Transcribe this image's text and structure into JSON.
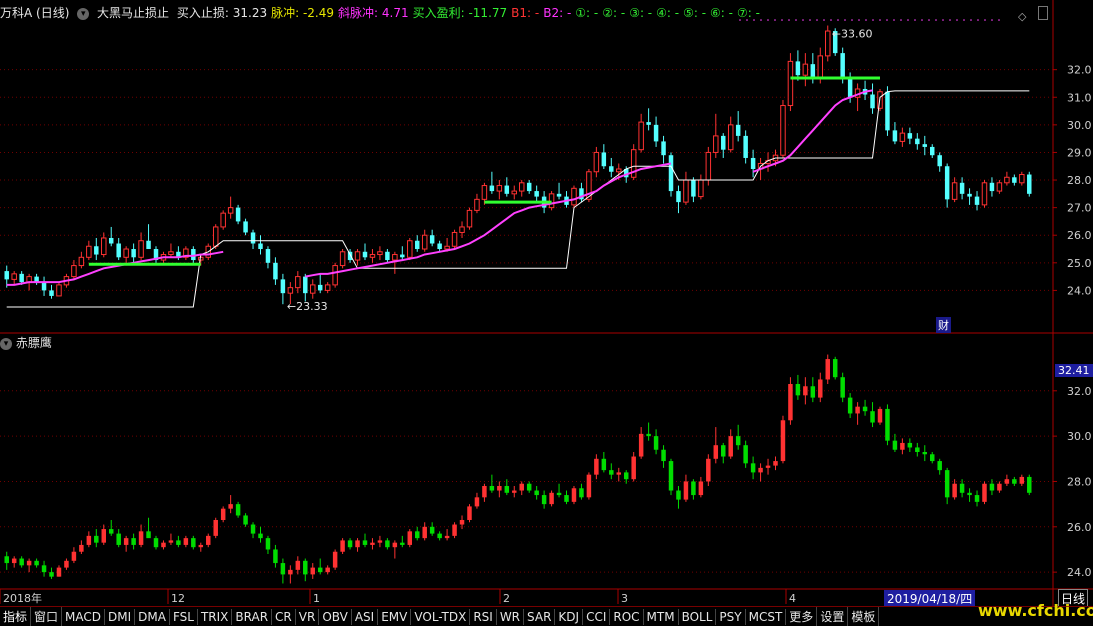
{
  "header": {
    "stock_name": "万科A (日线)",
    "indicator_name": "大黑马止损止",
    "items": [
      {
        "label": "买入止损: 31.23",
        "color": "#e6e6e6"
      },
      {
        "label": "脉冲: -2.49",
        "color": "#e6e600"
      },
      {
        "label": "斜脉冲: 4.71",
        "color": "#ff33ff"
      },
      {
        "label": "买入盈利: -11.77",
        "color": "#33ee33"
      },
      {
        "label": "B1: -",
        "color": "#ff3333"
      },
      {
        "label": "B2: -",
        "color": "#ff33ff"
      },
      {
        "label": "①: -",
        "color": "#33ee33"
      },
      {
        "label": "②: -",
        "color": "#33ee33"
      },
      {
        "label": "③: -",
        "color": "#33ee33"
      },
      {
        "label": "④: -",
        "color": "#33ee33"
      },
      {
        "label": "⑤: -",
        "color": "#33ee33"
      },
      {
        "label": "⑥: -",
        "color": "#33ee33"
      },
      {
        "label": "⑦: -",
        "color": "#33ee33"
      }
    ]
  },
  "sub_panel": {
    "title": "赤膘鹰"
  },
  "annotations": {
    "high": "33.60",
    "low": "23.33",
    "finance_badge": "财"
  },
  "crosshair": {
    "date": "2019/04/18/四",
    "price": "32.41"
  },
  "period": "日线",
  "toolbar": {
    "tabs": [
      "指标",
      "窗口",
      "MACD",
      "DMI",
      "DMA",
      "FSL",
      "TRIX",
      "BRAR",
      "CR",
      "VR",
      "OBV",
      "ASI",
      "EMV",
      "VOL-TDX",
      "RSI",
      "WR",
      "SAR",
      "KDJ",
      "CCI",
      "ROC",
      "MTM",
      "BOLL",
      "PSY",
      "MCST",
      "更多",
      "设置",
      "模板"
    ]
  },
  "watermark": "www.cfchi.com",
  "colors": {
    "up": "#ff3232",
    "down": "#54ffff",
    "down_sub": "#00dd00",
    "ma": "#ff40ff",
    "stop": "#ffffff",
    "bar_green": "#30ff30",
    "grid": "#700000"
  },
  "chart_data": [
    {
      "type": "candlestick",
      "title": "万科A (日线)",
      "x_labels": [
        "2018年",
        "12",
        "1",
        "2",
        "3",
        "4"
      ],
      "ylim": [
        23.0,
        33.8
      ],
      "y_ticks": [
        24.0,
        25.0,
        26.0,
        27.0,
        28.0,
        29.0,
        30.0,
        31.0,
        32.0
      ],
      "candles": [
        [
          24.7,
          24.9,
          24.1,
          24.4
        ],
        [
          24.4,
          24.7,
          24.2,
          24.6
        ],
        [
          24.6,
          24.7,
          24.2,
          24.3
        ],
        [
          24.3,
          24.6,
          24.0,
          24.5
        ],
        [
          24.5,
          24.6,
          24.2,
          24.3
        ],
        [
          24.3,
          24.5,
          23.8,
          24.0
        ],
        [
          24.0,
          24.2,
          23.7,
          23.8
        ],
        [
          23.8,
          24.3,
          23.8,
          24.2
        ],
        [
          24.2,
          24.6,
          24.1,
          24.5
        ],
        [
          24.5,
          25.1,
          24.4,
          24.9
        ],
        [
          24.9,
          25.4,
          24.8,
          25.2
        ],
        [
          25.2,
          25.8,
          25.1,
          25.6
        ],
        [
          25.6,
          25.9,
          25.1,
          25.3
        ],
        [
          25.3,
          26.1,
          25.2,
          25.9
        ],
        [
          25.9,
          26.3,
          25.6,
          25.7
        ],
        [
          25.7,
          25.9,
          25.1,
          25.2
        ],
        [
          25.2,
          25.6,
          24.9,
          25.5
        ],
        [
          25.5,
          25.7,
          25.0,
          25.2
        ],
        [
          25.2,
          26.1,
          25.1,
          25.8
        ],
        [
          25.8,
          26.4,
          25.6,
          25.5
        ],
        [
          25.5,
          25.6,
          25.0,
          25.1
        ],
        [
          25.1,
          25.4,
          25.0,
          25.3
        ],
        [
          25.3,
          25.7,
          25.2,
          25.4
        ],
        [
          25.4,
          25.6,
          25.1,
          25.2
        ],
        [
          25.2,
          25.6,
          25.1,
          25.5
        ],
        [
          25.5,
          25.6,
          25.0,
          25.1
        ],
        [
          25.1,
          25.3,
          24.9,
          25.2
        ],
        [
          25.2,
          25.7,
          25.1,
          25.6
        ],
        [
          25.6,
          26.4,
          25.5,
          26.3
        ],
        [
          26.3,
          26.9,
          26.2,
          26.8
        ],
        [
          26.8,
          27.4,
          26.6,
          27.0
        ],
        [
          27.0,
          27.1,
          26.4,
          26.5
        ],
        [
          26.5,
          26.6,
          26.0,
          26.1
        ],
        [
          26.1,
          26.2,
          25.5,
          25.7
        ],
        [
          25.7,
          26.0,
          25.3,
          25.5
        ],
        [
          25.5,
          25.6,
          24.8,
          25.0
        ],
        [
          25.0,
          25.2,
          24.2,
          24.4
        ],
        [
          24.4,
          24.6,
          23.5,
          23.9
        ],
        [
          23.9,
          24.3,
          23.5,
          24.1
        ],
        [
          24.1,
          24.7,
          23.9,
          24.5
        ],
        [
          24.5,
          24.6,
          23.6,
          23.9
        ],
        [
          23.9,
          24.4,
          23.7,
          24.2
        ],
        [
          24.2,
          24.6,
          23.9,
          24.0
        ],
        [
          24.0,
          24.3,
          23.9,
          24.2
        ],
        [
          24.2,
          25.0,
          24.1,
          24.9
        ],
        [
          24.9,
          25.5,
          24.8,
          25.4
        ],
        [
          25.4,
          25.5,
          25.0,
          25.1
        ],
        [
          25.1,
          25.5,
          24.9,
          25.4
        ],
        [
          25.4,
          25.7,
          25.1,
          25.2
        ],
        [
          25.2,
          25.5,
          25.0,
          25.3
        ],
        [
          25.3,
          25.6,
          25.1,
          25.4
        ],
        [
          25.4,
          25.5,
          25.0,
          25.1
        ],
        [
          25.1,
          25.4,
          24.6,
          25.3
        ],
        [
          25.3,
          25.6,
          25.1,
          25.2
        ],
        [
          25.2,
          25.9,
          25.1,
          25.8
        ],
        [
          25.8,
          26.0,
          25.4,
          25.5
        ],
        [
          25.5,
          26.2,
          25.4,
          26.0
        ],
        [
          26.0,
          26.2,
          25.6,
          25.7
        ],
        [
          25.7,
          25.8,
          25.4,
          25.5
        ],
        [
          25.5,
          25.9,
          25.4,
          25.6
        ],
        [
          25.6,
          26.2,
          25.5,
          26.1
        ],
        [
          26.1,
          26.5,
          25.9,
          26.3
        ],
        [
          26.3,
          27.0,
          26.2,
          26.9
        ],
        [
          26.9,
          27.5,
          26.8,
          27.3
        ],
        [
          27.3,
          27.9,
          27.1,
          27.8
        ],
        [
          27.8,
          28.3,
          27.5,
          27.6
        ],
        [
          27.6,
          28.0,
          27.3,
          27.8
        ],
        [
          27.8,
          28.1,
          27.4,
          27.5
        ],
        [
          27.5,
          27.8,
          27.3,
          27.6
        ],
        [
          27.6,
          28.0,
          27.4,
          27.9
        ],
        [
          27.9,
          28.0,
          27.5,
          27.6
        ],
        [
          27.6,
          27.8,
          27.2,
          27.4
        ],
        [
          27.4,
          27.6,
          26.8,
          27.0
        ],
        [
          27.0,
          27.6,
          26.9,
          27.5
        ],
        [
          27.5,
          27.9,
          27.3,
          27.4
        ],
        [
          27.4,
          27.6,
          27.0,
          27.1
        ],
        [
          27.1,
          27.8,
          27.0,
          27.7
        ],
        [
          27.7,
          27.9,
          27.2,
          27.3
        ],
        [
          27.3,
          28.4,
          27.2,
          28.3
        ],
        [
          28.3,
          29.2,
          28.1,
          29.0
        ],
        [
          29.0,
          29.3,
          28.4,
          28.5
        ],
        [
          28.5,
          28.8,
          28.1,
          28.3
        ],
        [
          28.3,
          28.6,
          28.0,
          28.4
        ],
        [
          28.4,
          28.5,
          27.9,
          28.1
        ],
        [
          28.1,
          29.3,
          28.0,
          29.1
        ],
        [
          29.1,
          30.4,
          29.0,
          30.1
        ],
        [
          30.1,
          30.6,
          29.8,
          30.0
        ],
        [
          30.0,
          30.3,
          29.2,
          29.4
        ],
        [
          29.4,
          29.6,
          28.6,
          28.9
        ],
        [
          28.9,
          29.0,
          27.4,
          27.6
        ],
        [
          27.6,
          27.8,
          26.8,
          27.2
        ],
        [
          27.2,
          28.3,
          27.1,
          28.0
        ],
        [
          28.0,
          28.1,
          27.2,
          27.4
        ],
        [
          27.4,
          28.2,
          27.3,
          28.0
        ],
        [
          28.0,
          29.2,
          27.8,
          29.0
        ],
        [
          29.0,
          30.4,
          28.8,
          29.6
        ],
        [
          29.6,
          29.7,
          28.8,
          29.1
        ],
        [
          29.1,
          30.3,
          29.0,
          30.0
        ],
        [
          30.0,
          30.5,
          29.4,
          29.6
        ],
        [
          29.6,
          29.8,
          28.6,
          28.8
        ],
        [
          28.8,
          29.1,
          28.1,
          28.4
        ],
        [
          28.4,
          28.8,
          28.0,
          28.6
        ],
        [
          28.6,
          29.0,
          28.3,
          28.7
        ],
        [
          28.7,
          29.1,
          28.5,
          28.9
        ],
        [
          28.9,
          30.9,
          28.8,
          30.7
        ],
        [
          30.7,
          32.6,
          30.5,
          32.3
        ],
        [
          32.3,
          32.7,
          31.6,
          31.8
        ],
        [
          31.8,
          32.6,
          31.4,
          32.2
        ],
        [
          32.2,
          32.6,
          31.5,
          31.7
        ],
        [
          31.7,
          32.8,
          31.5,
          32.5
        ],
        [
          32.5,
          33.6,
          32.3,
          33.4
        ],
        [
          33.4,
          33.5,
          32.5,
          32.6
        ],
        [
          32.6,
          32.8,
          31.5,
          31.7
        ],
        [
          31.7,
          31.9,
          30.8,
          31.0
        ],
        [
          31.0,
          31.5,
          30.5,
          31.3
        ],
        [
          31.3,
          31.6,
          30.9,
          31.1
        ],
        [
          31.1,
          31.5,
          30.4,
          30.6
        ],
        [
          30.6,
          31.3,
          30.5,
          31.2
        ],
        [
          31.2,
          31.4,
          29.6,
          29.8
        ],
        [
          29.8,
          30.1,
          29.3,
          29.4
        ],
        [
          29.4,
          29.9,
          29.2,
          29.7
        ],
        [
          29.7,
          29.9,
          29.3,
          29.5
        ],
        [
          29.5,
          29.7,
          29.1,
          29.3
        ],
        [
          29.3,
          29.6,
          28.9,
          29.2
        ],
        [
          29.2,
          29.3,
          28.8,
          28.9
        ],
        [
          28.9,
          29.0,
          28.3,
          28.5
        ],
        [
          28.5,
          28.6,
          27.0,
          27.3
        ],
        [
          27.3,
          28.1,
          27.2,
          27.9
        ],
        [
          27.9,
          28.1,
          27.3,
          27.5
        ],
        [
          27.5,
          27.7,
          27.1,
          27.4
        ],
        [
          27.4,
          27.6,
          26.9,
          27.1
        ],
        [
          27.1,
          28.0,
          27.0,
          27.9
        ],
        [
          27.9,
          28.1,
          27.4,
          27.6
        ],
        [
          27.6,
          28.0,
          27.5,
          27.9
        ],
        [
          27.9,
          28.3,
          27.8,
          28.1
        ],
        [
          28.1,
          28.2,
          27.8,
          27.9
        ],
        [
          27.9,
          28.3,
          27.8,
          28.2
        ],
        [
          28.2,
          28.3,
          27.4,
          27.5
        ]
      ],
      "ma_line": [
        24.2,
        24.2,
        24.25,
        24.3,
        24.3,
        24.3,
        24.3,
        24.3,
        24.35,
        24.4,
        24.5,
        24.6,
        24.7,
        24.8,
        24.85,
        24.9,
        24.95,
        25.0,
        25.05,
        25.1,
        25.15,
        25.2,
        25.2,
        25.2,
        25.25,
        25.25,
        25.3,
        25.3,
        25.35,
        25.4,
        null,
        null,
        null,
        null,
        null,
        null,
        null,
        null,
        null,
        null,
        24.5,
        24.55,
        24.6,
        24.6,
        24.65,
        24.7,
        24.75,
        24.8,
        24.85,
        24.9,
        24.95,
        25.0,
        25.05,
        25.1,
        25.15,
        25.2,
        25.3,
        25.35,
        25.4,
        25.45,
        25.5,
        25.6,
        25.7,
        25.85,
        26.0,
        26.2,
        26.4,
        26.6,
        26.8,
        26.9,
        27.0,
        27.05,
        27.1,
        27.15,
        27.2,
        27.25,
        27.3,
        27.4,
        27.5,
        27.6,
        27.8,
        27.95,
        28.1,
        28.2,
        28.3,
        28.4,
        28.45,
        28.5,
        28.55,
        28.6,
        null,
        null,
        null,
        null,
        null,
        null,
        null,
        null,
        null,
        null,
        28.3,
        28.4,
        28.5,
        28.6,
        28.7,
        28.9,
        29.2,
        29.5,
        29.8,
        30.1,
        30.4,
        30.7,
        30.9,
        31.0,
        31.1,
        31.2,
        31.25,
        null,
        null,
        null,
        null,
        null,
        null,
        null,
        null,
        null,
        null,
        null,
        null,
        null,
        null,
        null,
        null,
        null,
        null,
        null,
        null,
        null,
        null,
        null,
        null,
        null,
        null,
        null,
        null,
        null,
        null
      ],
      "stop_line": [
        23.4,
        23.4,
        23.4,
        23.4,
        23.4,
        23.4,
        23.4,
        23.4,
        23.4,
        23.4,
        23.4,
        23.4,
        23.4,
        23.4,
        23.4,
        23.4,
        23.4,
        23.4,
        23.4,
        23.4,
        23.4,
        23.4,
        23.4,
        23.4,
        23.4,
        23.4,
        25.3,
        25.4,
        25.6,
        25.8,
        25.8,
        25.8,
        25.8,
        25.8,
        25.8,
        25.8,
        25.8,
        25.8,
        25.8,
        25.8,
        25.8,
        25.8,
        25.8,
        25.8,
        25.8,
        25.8,
        25.3,
        24.8,
        24.8,
        24.8,
        24.8,
        24.8,
        24.8,
        24.8,
        24.8,
        24.8,
        24.8,
        24.8,
        24.8,
        24.8,
        24.8,
        24.8,
        24.8,
        24.8,
        24.8,
        24.8,
        24.8,
        24.8,
        24.8,
        24.8,
        24.8,
        24.8,
        24.8,
        24.8,
        24.8,
        24.8,
        27.0,
        27.2,
        27.4,
        27.6,
        27.8,
        28.0,
        28.2,
        28.4,
        28.5,
        28.5,
        28.5,
        28.5,
        28.5,
        28.5,
        28.0,
        28.0,
        28.0,
        28.0,
        28.0,
        28.0,
        28.0,
        28.0,
        28.0,
        28.0,
        28.0,
        28.5,
        28.7,
        28.8,
        28.8,
        28.8,
        28.8,
        28.8,
        28.8,
        28.8,
        28.8,
        28.8,
        28.8,
        28.8,
        28.8,
        28.8,
        28.8,
        31.0,
        31.2,
        31.23,
        31.23,
        31.23,
        31.23,
        31.23,
        31.23,
        31.23,
        31.23,
        31.23,
        31.23,
        31.23,
        31.23,
        31.23,
        31.23,
        31.23,
        31.23,
        31.23,
        31.23,
        31.23,
        31.23,
        31.23,
        31.23,
        31.23,
        31.23,
        31.23,
        31.23,
        31.23,
        31.23,
        31.23,
        31.23,
        31.23
      ],
      "green_bars": [
        {
          "from": 11,
          "to": 26,
          "value": 24.95
        },
        {
          "from": 64,
          "to": 73,
          "value": 27.2
        },
        {
          "from": 105,
          "to": 117,
          "value": 31.7
        }
      ]
    },
    {
      "type": "candlestick",
      "title": "赤膘鹰",
      "ylim": [
        23.3,
        33.8
      ],
      "y_ticks": [
        24.0,
        26.0,
        28.0,
        30.0,
        32.0
      ]
    }
  ]
}
